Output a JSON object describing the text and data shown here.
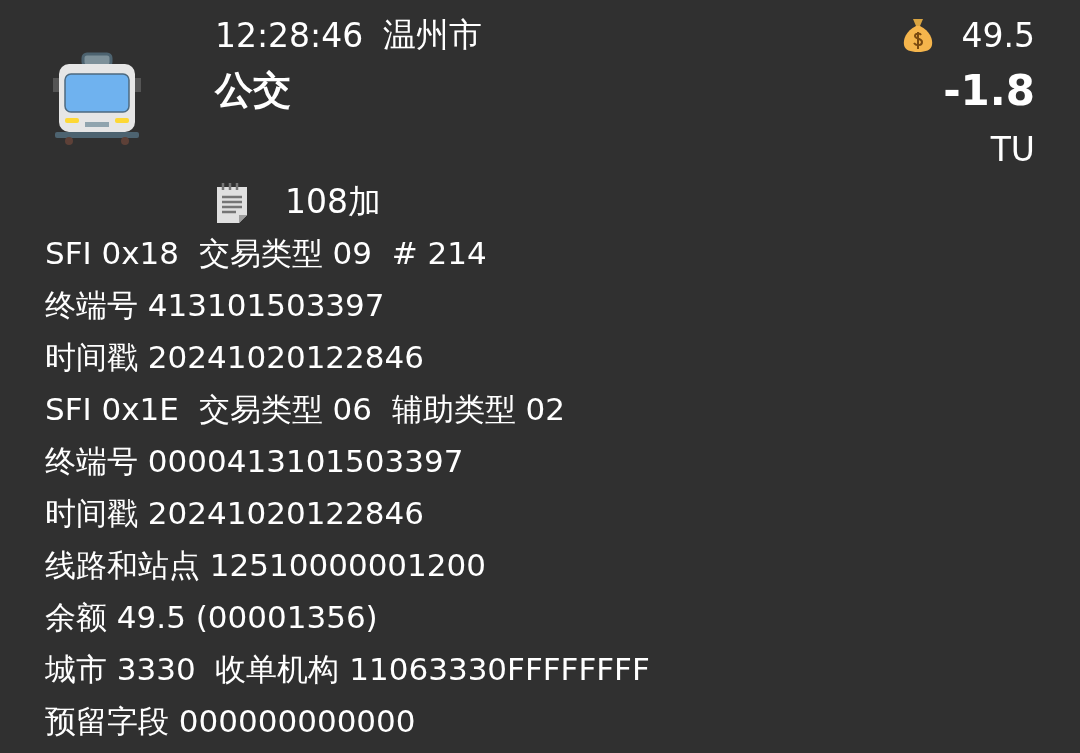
{
  "header": {
    "time": "12:28:46",
    "city": "温州市",
    "title": "公交",
    "balance": "49.5",
    "amount": "-1.8",
    "unit": "TU"
  },
  "note": {
    "text": "108加"
  },
  "lines": [
    "SFI 0x18  交易类型 09  # 214",
    "终端号 413101503397",
    "时间戳 20241020122846",
    "SFI 0x1E  交易类型 06  辅助类型 02",
    "终端号 0000413101503397",
    "时间戳 20241020122846",
    "线路和站点 12510000001200",
    "余额 49.5 (00001356)",
    "城市 3330  收单机构 11063330FFFFFFFF",
    "预留字段 000000000000"
  ]
}
